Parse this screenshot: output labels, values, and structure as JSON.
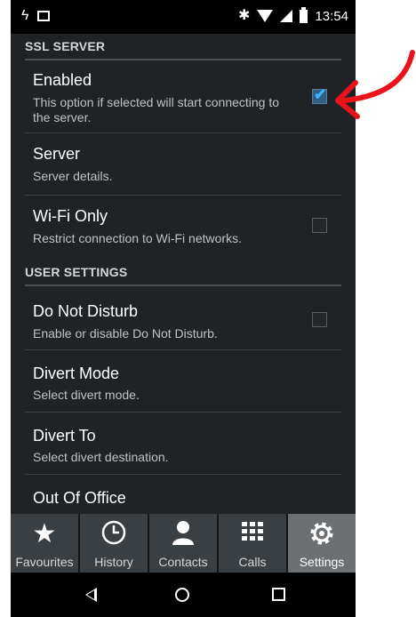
{
  "status_bar": {
    "left_icons": [
      "lightning-icon",
      "image-icon"
    ],
    "right_icons": [
      "bluetooth-icon",
      "wifi-icon",
      "signal-icon",
      "battery-icon"
    ],
    "time": "13:54"
  },
  "settings": {
    "ssl_header": "SSL SERVER",
    "enabled": {
      "title": "Enabled",
      "subtitle": "This option if selected will start connecting to the server.",
      "checked": true
    },
    "server": {
      "title": "Server",
      "subtitle": "Server details."
    },
    "wifi_only": {
      "title": "Wi-Fi Only",
      "subtitle": "Restrict connection to Wi-Fi networks.",
      "checked": false
    },
    "user_header": "USER SETTINGS",
    "dnd": {
      "title": "Do Not Disturb",
      "subtitle": "Enable or disable Do Not Disturb.",
      "checked": false
    },
    "divert_mode": {
      "title": "Divert Mode",
      "subtitle": "Select divert mode."
    },
    "divert_to": {
      "title": "Divert To",
      "subtitle": "Select divert destination."
    },
    "out_of_office": {
      "title": "Out Of Office"
    }
  },
  "tabs": [
    {
      "label": "Favourites",
      "icon": "star-icon"
    },
    {
      "label": "History",
      "icon": "clock-icon"
    },
    {
      "label": "Contacts",
      "icon": "person-icon"
    },
    {
      "label": "Calls",
      "icon": "dialpad-icon"
    },
    {
      "label": "Settings",
      "icon": "gear-icon",
      "active": true
    }
  ],
  "nav": {
    "icons": [
      "back-icon",
      "home-icon",
      "recents-icon"
    ]
  },
  "annotation": {
    "color": "#e8131b"
  },
  "colors": {
    "accent": "#39b5ff",
    "background": "#1f2326"
  }
}
